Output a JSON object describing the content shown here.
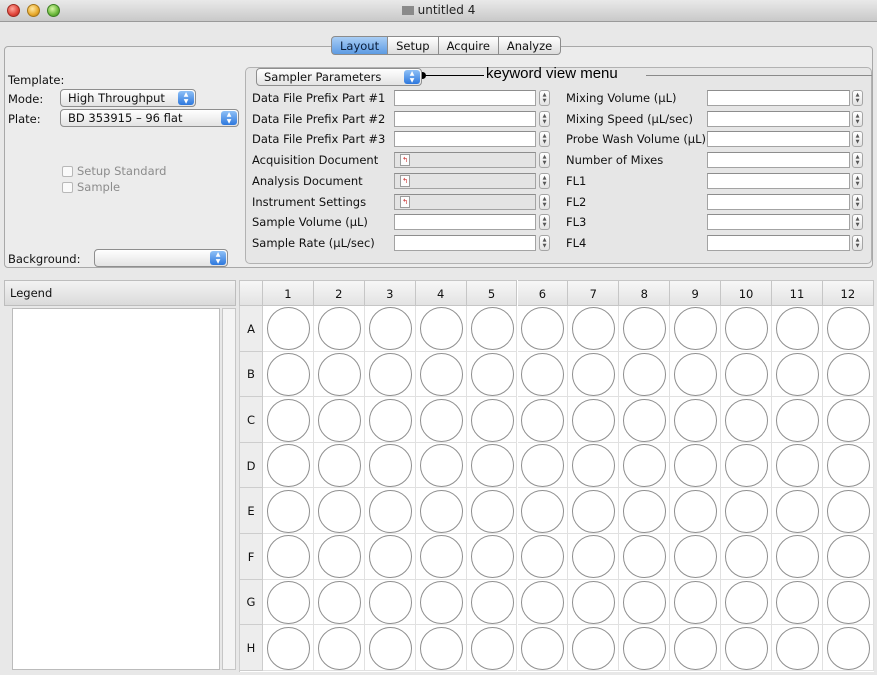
{
  "window": {
    "title": "untitled 4"
  },
  "tabs": [
    "Layout",
    "Setup",
    "Acquire",
    "Analyze"
  ],
  "active_tab": "Layout",
  "left_panel": {
    "template_label": "Template:",
    "mode_label": "Mode:",
    "mode_value": "High Throughput",
    "plate_label": "Plate:",
    "plate_value": "BD 353915 – 96 flat",
    "setup_standard_label": "Setup Standard",
    "sample_label": "Sample",
    "background_label": "Background:",
    "background_value": ""
  },
  "keyword_menu": {
    "selected": "Sampler Parameters"
  },
  "annotation": "keyword view menu",
  "parameters_left": [
    {
      "label": "Data File Prefix Part #1",
      "value": "",
      "disabled": false,
      "file_icon": false
    },
    {
      "label": "Data File Prefix Part #2",
      "value": "",
      "disabled": false,
      "file_icon": false
    },
    {
      "label": "Data File Prefix Part #3",
      "value": "",
      "disabled": false,
      "file_icon": false
    },
    {
      "label": "Acquisition Document",
      "value": "",
      "disabled": true,
      "file_icon": true
    },
    {
      "label": "Analysis Document",
      "value": "",
      "disabled": true,
      "file_icon": true
    },
    {
      "label": "Instrument Settings",
      "value": "",
      "disabled": true,
      "file_icon": true
    },
    {
      "label": "Sample Volume (µL)",
      "value": "",
      "disabled": false,
      "file_icon": false
    },
    {
      "label": "Sample Rate (µL/sec)",
      "value": "",
      "disabled": false,
      "file_icon": false
    }
  ],
  "parameters_right": [
    {
      "label": "Mixing Volume (µL)",
      "value": ""
    },
    {
      "label": "Mixing Speed (µL/sec)",
      "value": ""
    },
    {
      "label": "Probe Wash Volume (µL)",
      "value": ""
    },
    {
      "label": "Number of Mixes",
      "value": ""
    },
    {
      "label": "FL1",
      "value": ""
    },
    {
      "label": "FL2",
      "value": ""
    },
    {
      "label": "FL3",
      "value": ""
    },
    {
      "label": "FL4",
      "value": ""
    }
  ],
  "legend": {
    "title": "Legend"
  },
  "plate": {
    "columns": [
      "1",
      "2",
      "3",
      "4",
      "5",
      "6",
      "7",
      "8",
      "9",
      "10",
      "11",
      "12"
    ],
    "rows": [
      "A",
      "B",
      "C",
      "D",
      "E",
      "F",
      "G",
      "H"
    ]
  }
}
